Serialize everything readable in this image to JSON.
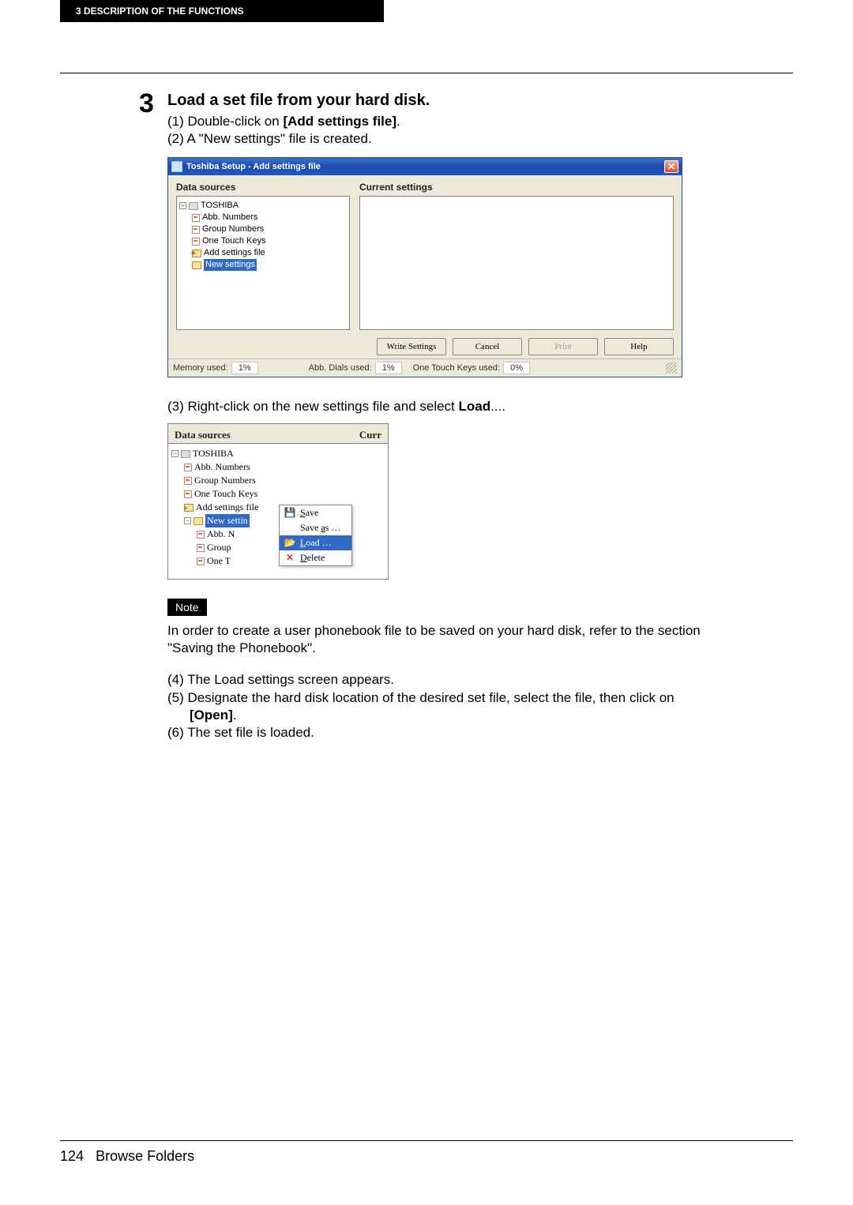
{
  "header": {
    "chapter_label": "3    DESCRIPTION OF THE FUNCTIONS"
  },
  "step": {
    "number": "3",
    "heading": "Load a set file from your hard disk.",
    "line1_pre": "(1) Double-click on ",
    "line1_bold": "[Add settings file]",
    "line1_post": ".",
    "line2": "(2) A \"New settings\" file is created."
  },
  "win1": {
    "title": "Toshiba Setup - Add settings file",
    "col_left": "Data sources",
    "col_right": "Current settings",
    "tree": {
      "root": "TOSHIBA",
      "items": [
        "Abb. Numbers",
        "Group Numbers",
        "One Touch Keys"
      ],
      "add": "Add settings file",
      "new": "New settings"
    },
    "buttons": {
      "write": "Write Settings",
      "cancel": "Cancel",
      "print": "Print",
      "help": "Help"
    },
    "status": {
      "mem_label": "Memory used:",
      "mem_val": "1%",
      "abb_label": "Abb. Dials used:",
      "abb_val": "1%",
      "otk_label": "One Touch Keys used:",
      "otk_val": "0%"
    }
  },
  "mid_text": {
    "line3_pre": "(3) Right-click on the new settings file and select ",
    "line3_bold": "Load",
    "line3_post": "...."
  },
  "panel2": {
    "left_head": "Data sources",
    "right_head": "Curr",
    "tree": {
      "root": "TOSHIBA",
      "items": [
        "Abb. Numbers",
        "Group Numbers",
        "One Touch Keys"
      ],
      "add": "Add settings file",
      "new": "New settin",
      "sub": [
        "Abb. N",
        "Group",
        "One T"
      ]
    },
    "menu": {
      "save": "Save",
      "saveas": "Save as …",
      "load": "Load …",
      "delete": "Delete"
    }
  },
  "note": {
    "badge": "Note",
    "text": "In order to create a user phonebook file to be saved on your hard disk, refer to the section \"Saving the Phonebook\"."
  },
  "tail": {
    "line4": "(4) The Load settings screen appears.",
    "line5_pre": "(5) Designate the hard disk location of the desired set file, select the file, then click on ",
    "line5_bold": "[Open]",
    "line5_post": ".",
    "line6": "(6) The set file is loaded."
  },
  "footer": {
    "page": "124",
    "section": "Browse Folders"
  }
}
